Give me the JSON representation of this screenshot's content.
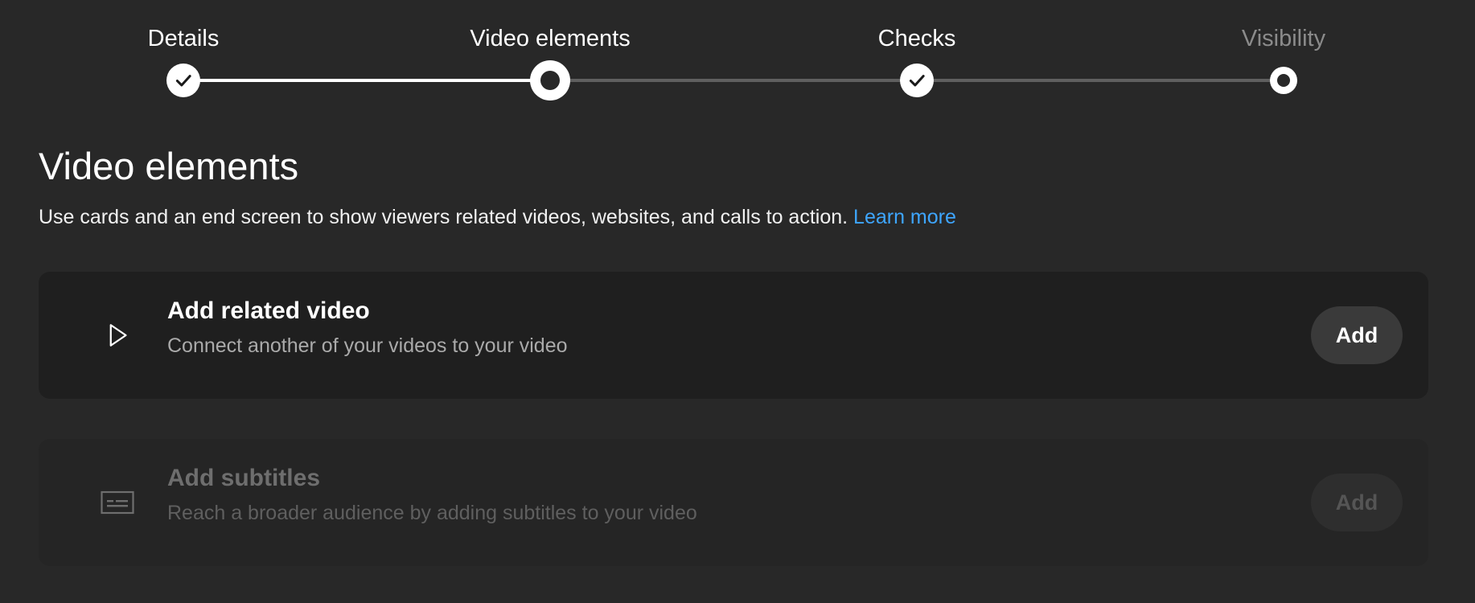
{
  "stepper": {
    "steps": [
      {
        "label": "Details",
        "state": "completed"
      },
      {
        "label": "Video elements",
        "state": "current"
      },
      {
        "label": "Checks",
        "state": "completed"
      },
      {
        "label": "Visibility",
        "state": "pending"
      }
    ]
  },
  "main": {
    "title": "Video elements",
    "description": "Use cards and an end screen to show viewers related videos, websites, and calls to action.",
    "learn_more": "Learn more"
  },
  "cards": [
    {
      "icon": "play-icon",
      "title": "Add related video",
      "subtitle": "Connect another of your videos to your video",
      "button_label": "Add",
      "enabled": true
    },
    {
      "icon": "subtitles-icon",
      "title": "Add subtitles",
      "subtitle": "Reach a broader audience by adding subtitles to your video",
      "button_label": "Add",
      "enabled": false
    }
  ],
  "colors": {
    "background": "#282828",
    "card": "#1f1f1f",
    "link": "#3ea6ff",
    "button": "#3a3a3a"
  }
}
